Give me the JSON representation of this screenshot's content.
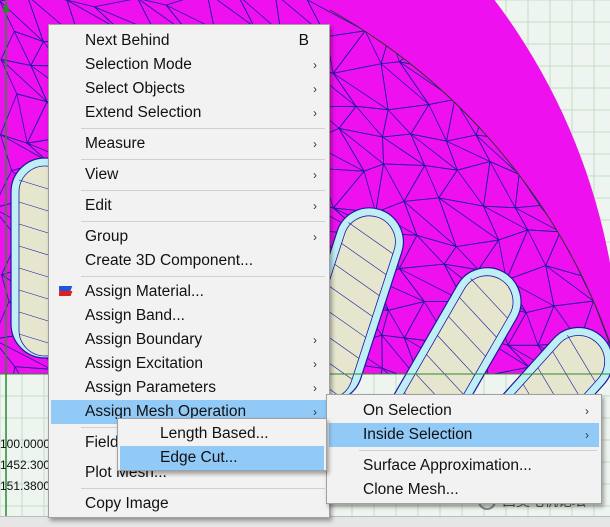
{
  "colors": {
    "domain": "#ee10ee",
    "mesh_line": "#1a1aa0",
    "slot_fill": "#e6e6cf",
    "slot_inner": "#bfeff5",
    "grid_bg": "#eef4ef",
    "grid_line": "#c6dcc6",
    "menu_bg": "#f2f2f2",
    "highlight": "#91c9f7"
  },
  "coordinates": [
    "100.0000",
    "1452.300",
    "151.3800"
  ],
  "context_menu": {
    "items": [
      {
        "label": "Next Behind",
        "accelerator": "B",
        "submenu": false
      },
      {
        "label": "Selection Mode",
        "submenu": true
      },
      {
        "label": "Select Objects",
        "submenu": true
      },
      {
        "label": "Extend Selection",
        "submenu": true
      },
      {
        "label": "Measure",
        "submenu": true
      },
      {
        "label": "View",
        "submenu": true
      },
      {
        "label": "Edit",
        "submenu": true
      },
      {
        "label": "Group",
        "submenu": true
      },
      {
        "label": "Create 3D Component...",
        "submenu": false
      },
      {
        "label": "Assign Material...",
        "submenu": false,
        "icon": "material-icon"
      },
      {
        "label": "Assign Band...",
        "submenu": false
      },
      {
        "label": "Assign Boundary",
        "submenu": true
      },
      {
        "label": "Assign Excitation",
        "submenu": true
      },
      {
        "label": "Assign Parameters",
        "submenu": true
      },
      {
        "label": "Assign Mesh Operation",
        "submenu": true,
        "highlighted": true
      },
      {
        "label": "Fields",
        "submenu": true
      },
      {
        "label": "Plot Mesh...",
        "submenu": false
      },
      {
        "label": "Copy Image",
        "submenu": false
      }
    ]
  },
  "mesh_operation_menu": {
    "items": [
      {
        "label": "On Selection",
        "submenu": true
      },
      {
        "label": "Inside Selection",
        "submenu": true,
        "highlighted": true
      },
      {
        "label": "Surface Approximation...",
        "submenu": false
      },
      {
        "label": "Clone Mesh...",
        "submenu": false
      }
    ]
  },
  "inside_selection_menu": {
    "items": [
      {
        "label": "Length Based...",
        "highlighted": false
      },
      {
        "label": "Edge Cut...",
        "highlighted": true
      }
    ]
  },
  "watermark": {
    "text": "西莫电机论坛",
    "icon": "wechat-icon"
  }
}
